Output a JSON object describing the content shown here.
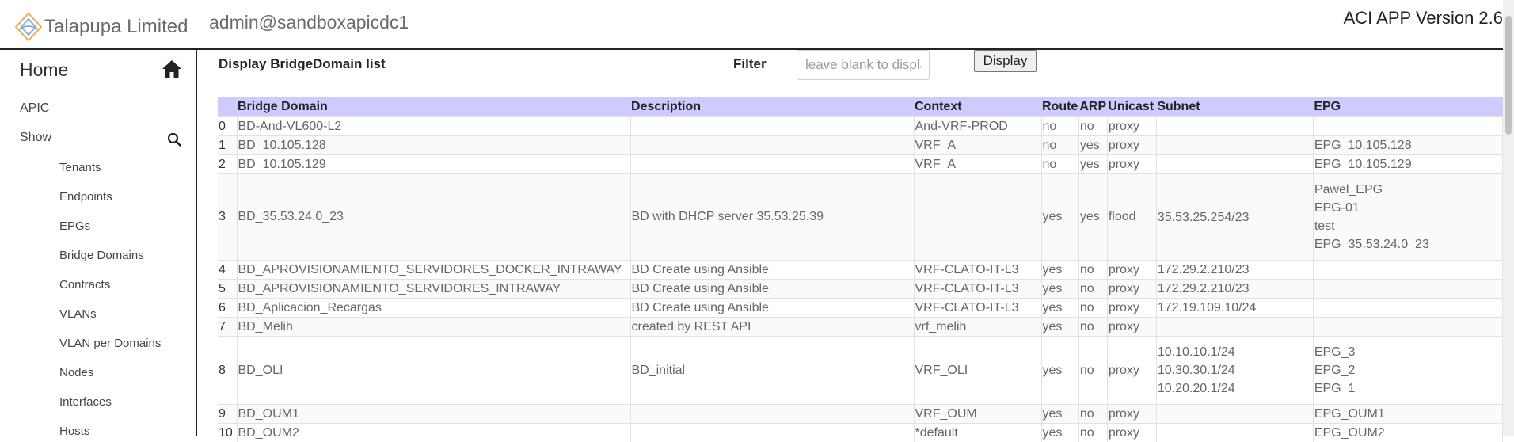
{
  "header": {
    "brand": "Talapupa Limited",
    "user": "admin@sandboxapicdc1",
    "version": "ACI APP Version 2.6"
  },
  "sidebar": {
    "home_label": "Home",
    "home_icon": "home-icon",
    "apic_label": "APIC",
    "show_label": "Show",
    "search_icon": "search-icon",
    "items": [
      {
        "label": "Tenants"
      },
      {
        "label": "Endpoints"
      },
      {
        "label": "EPGs"
      },
      {
        "label": "Bridge Domains"
      },
      {
        "label": "Contracts"
      },
      {
        "label": "VLANs"
      },
      {
        "label": "VLAN per Domains"
      },
      {
        "label": "Nodes"
      },
      {
        "label": "Interfaces"
      },
      {
        "label": "Hosts"
      }
    ]
  },
  "main": {
    "heading": "Display BridgeDomain list",
    "filter_label": "Filter",
    "filter_placeholder": "leave blank to display all",
    "filter_value": "",
    "display_button": "Display",
    "table": {
      "headers": [
        "",
        "Bridge Domain",
        "Description",
        "Context",
        "Route",
        "ARP",
        "Unicast",
        "Subnet",
        "EPG"
      ],
      "rows": [
        {
          "idx": "0",
          "bd": "BD-And-VL600-L2",
          "desc": "",
          "ctx": "And-VRF-PROD",
          "route": "no",
          "arp": "no",
          "unicast": "proxy",
          "subnet": [],
          "epg": []
        },
        {
          "idx": "1",
          "bd": "BD_10.105.128",
          "desc": "",
          "ctx": "VRF_A",
          "route": "no",
          "arp": "yes",
          "unicast": "proxy",
          "subnet": [],
          "epg": [
            "EPG_10.105.128"
          ]
        },
        {
          "idx": "2",
          "bd": "BD_10.105.129",
          "desc": "",
          "ctx": "VRF_A",
          "route": "no",
          "arp": "yes",
          "unicast": "proxy",
          "subnet": [],
          "epg": [
            "EPG_10.105.129"
          ]
        },
        {
          "idx": "3",
          "bd": "BD_35.53.24.0_23",
          "desc": "BD with DHCP server 35.53.25.39",
          "ctx": "",
          "route": "yes",
          "arp": "yes",
          "unicast": "flood",
          "subnet": [
            "35.53.25.254/23"
          ],
          "epg": [
            "Pawel_EPG",
            "EPG-01",
            "test",
            "EPG_35.53.24.0_23"
          ]
        },
        {
          "idx": "4",
          "bd": "BD_APROVISIONAMIENTO_SERVIDORES_DOCKER_INTRAWAY",
          "desc": "BD Create using Ansible",
          "ctx": "VRF-CLATO-IT-L3",
          "route": "yes",
          "arp": "no",
          "unicast": "proxy",
          "subnet": [
            "172.29.2.210/23"
          ],
          "epg": []
        },
        {
          "idx": "5",
          "bd": "BD_APROVISIONAMIENTO_SERVIDORES_INTRAWAY",
          "desc": "BD Create using Ansible",
          "ctx": "VRF-CLATO-IT-L3",
          "route": "yes",
          "arp": "no",
          "unicast": "proxy",
          "subnet": [
            "172.29.2.210/23"
          ],
          "epg": []
        },
        {
          "idx": "6",
          "bd": "BD_Aplicacion_Recargas",
          "desc": "BD Create using Ansible",
          "ctx": "VRF-CLATO-IT-L3",
          "route": "yes",
          "arp": "no",
          "unicast": "proxy",
          "subnet": [
            "172.19.109.10/24"
          ],
          "epg": []
        },
        {
          "idx": "7",
          "bd": "BD_Melih",
          "desc": "created by REST API",
          "ctx": "vrf_melih",
          "route": "yes",
          "arp": "no",
          "unicast": "proxy",
          "subnet": [],
          "epg": []
        },
        {
          "idx": "8",
          "bd": "BD_OLI",
          "desc": "BD_initial",
          "ctx": "VRF_OLI",
          "route": "yes",
          "arp": "no",
          "unicast": "proxy",
          "subnet": [
            "10.10.10.1/24",
            "10.30.30.1/24",
            "10.20.20.1/24"
          ],
          "epg": [
            "EPG_3",
            "EPG_2",
            "EPG_1"
          ]
        },
        {
          "idx": "9",
          "bd": "BD_OUM1",
          "desc": "",
          "ctx": "VRF_OUM",
          "route": "yes",
          "arp": "no",
          "unicast": "proxy",
          "subnet": [],
          "epg": [
            "EPG_OUM1"
          ]
        },
        {
          "idx": "10",
          "bd": "BD_OUM2",
          "desc": "",
          "ctx": "*default",
          "route": "yes",
          "arp": "no",
          "unicast": "proxy",
          "subnet": [],
          "epg": [
            "EPG_OUM2"
          ]
        }
      ]
    }
  }
}
